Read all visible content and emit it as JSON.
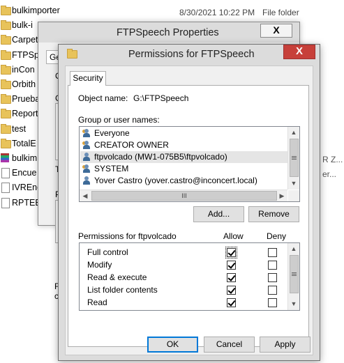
{
  "explorer": {
    "rows": [
      {
        "name": "bulkimporter",
        "date": "8/30/2021 10:22 PM",
        "type": "File folder",
        "icon": "folder-icon"
      },
      {
        "name": "bulk-i",
        "icon": "folder-icon"
      },
      {
        "name": "Carpet",
        "icon": "folder-icon"
      },
      {
        "name": "FTPSp",
        "icon": "folder-icon",
        "selected": true
      },
      {
        "name": "inCon",
        "icon": "folder-icon"
      },
      {
        "name": "Orbith",
        "icon": "folder-icon"
      },
      {
        "name": "Prueba",
        "icon": "folder-icon"
      },
      {
        "name": "Report",
        "icon": "folder-icon"
      },
      {
        "name": "test",
        "icon": "folder-icon"
      },
      {
        "name": "TotalE",
        "icon": "folder-icon"
      },
      {
        "name": "bulkim",
        "icon": "rar-icon"
      },
      {
        "name": "Encue",
        "icon": "file-icon"
      },
      {
        "name": "IVREnc",
        "icon": "file-icon"
      },
      {
        "name": "RPTEE",
        "icon": "file-icon"
      }
    ],
    "ghost_text": [
      "R Z...",
      "er..."
    ]
  },
  "properties_dialog": {
    "title": "FTPSpeech Properties",
    "close": "X",
    "tab_partial": "Ge",
    "fragments": [
      "O",
      "G",
      "T",
      "P",
      "F",
      "c"
    ]
  },
  "permissions_dialog": {
    "title": "Permissions for FTPSpeech",
    "close": "X",
    "tab": "Security",
    "object_name_label": "Object name:",
    "object_name_value": "G:\\FTPSpeech",
    "group_label": "Group or user names:",
    "users": [
      {
        "name": "Everyone",
        "icon": "group-icon"
      },
      {
        "name": "CREATOR OWNER",
        "icon": "group-icon"
      },
      {
        "name": "ftpvolcado (MW1-075B5\\ftpvolcado)",
        "icon": "user-icon",
        "selected": true
      },
      {
        "name": "SYSTEM",
        "icon": "group-icon"
      },
      {
        "name": "Yover Castro (yover.castro@inconcert.local)",
        "icon": "user-icon"
      }
    ],
    "hscroll_thumb": "III",
    "add_button": "Add...",
    "remove_button": "Remove",
    "permissions_label": "Permissions for ftpvolcado",
    "allow_header": "Allow",
    "deny_header": "Deny",
    "permissions": [
      {
        "name": "Full control",
        "allow": true,
        "deny": false
      },
      {
        "name": "Modify",
        "allow": true,
        "deny": false
      },
      {
        "name": "Read & execute",
        "allow": true,
        "deny": false
      },
      {
        "name": "List folder contents",
        "allow": true,
        "deny": false
      },
      {
        "name": "Read",
        "allow": true,
        "deny": false
      }
    ],
    "ok_button": "OK",
    "cancel_button": "Cancel",
    "apply_button": "Apply"
  }
}
